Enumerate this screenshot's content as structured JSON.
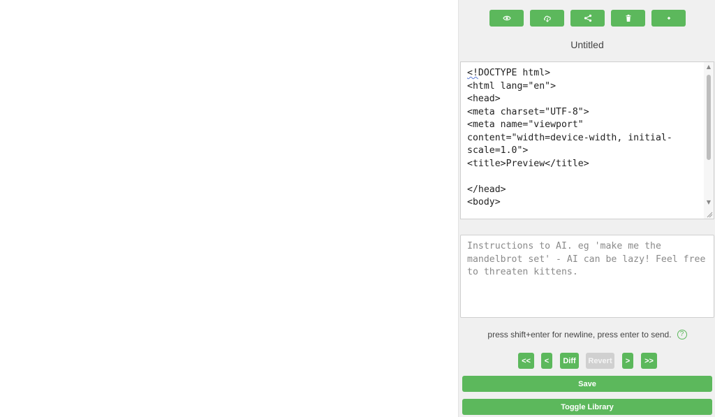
{
  "toolbar": {
    "buttons": [
      {
        "icon": "eye-icon"
      },
      {
        "icon": "cloud-download-icon"
      },
      {
        "icon": "share-icon"
      },
      {
        "icon": "trash-icon"
      },
      {
        "icon": "plus-icon"
      }
    ]
  },
  "document": {
    "title": "Untitled"
  },
  "editor": {
    "lines": [
      "<!DOCTYPE html>",
      "<html lang=\"en\">",
      "<head>",
      "<meta charset=\"UTF-8\">",
      "<meta name=\"viewport\"",
      "content=\"width=device-width, initial-",
      "scale=1.0\">",
      "<title>Preview</title>",
      "",
      "</head>",
      "<body>"
    ]
  },
  "ai_prompt": {
    "placeholder": "Instructions to AI. eg 'make me the mandelbrot set' - AI can be lazy! Feel free to threaten kittens.",
    "value": ""
  },
  "hint": {
    "text": "press shift+enter for newline, press enter to send.",
    "help_symbol": "?"
  },
  "history_nav": {
    "first_label": "<<",
    "prev_label": "<",
    "diff_label": "Diff",
    "revert_label": "Revert",
    "next_label": ">",
    "last_label": ">>"
  },
  "actions": {
    "save_label": "Save",
    "toggle_library_label": "Toggle Library"
  },
  "colors": {
    "accent": "#5cb85c",
    "disabled": "#d0d0d0",
    "panel_background": "#f0f0f0"
  }
}
